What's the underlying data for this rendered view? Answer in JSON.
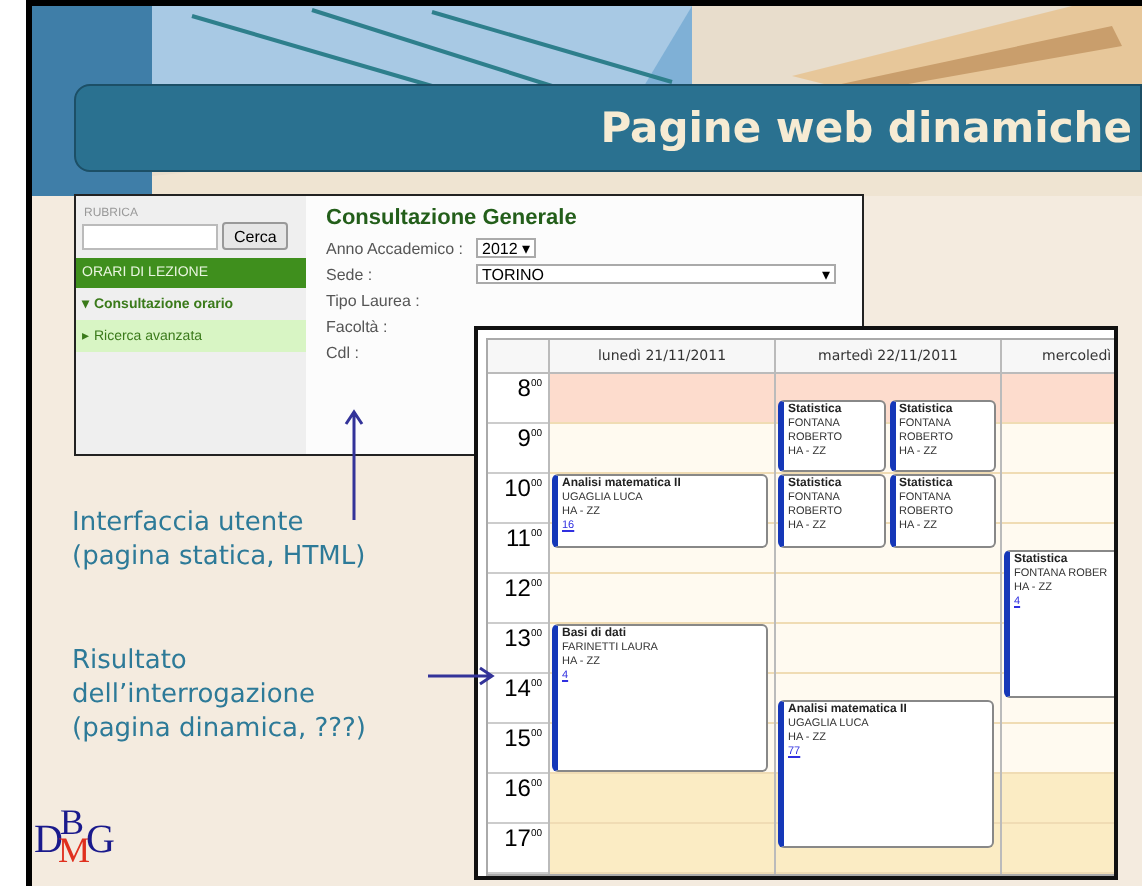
{
  "slide": {
    "title": "Pagine web dinamiche",
    "static_page": {
      "sidebar": {
        "label": "RUBRICA",
        "search_button": "Cerca",
        "section": "ORARI DI LEZIONE",
        "items": [
          {
            "marker": "▾",
            "label": "Consultazione orario",
            "selected": false
          },
          {
            "marker": "▸",
            "label": "Ricerca avanzata",
            "selected": true
          }
        ]
      },
      "heading": "Consultazione Generale",
      "fields": [
        {
          "label": "Anno Accademico :",
          "value": "2012",
          "kind": "short"
        },
        {
          "label": "Sede :",
          "value": "TORINO",
          "kind": "wide"
        },
        {
          "label": "Tipo Laurea :",
          "kind": "hidden"
        },
        {
          "label": "Facoltà :",
          "kind": "none"
        },
        {
          "label": "Cdl :",
          "kind": "none"
        }
      ]
    },
    "timetable": {
      "days": [
        "lunedì 21/11/2011",
        "martedì 22/11/2011",
        "mercoledì"
      ],
      "hours": [
        "8$^{00}$",
        "9$^{00}$",
        "10$^{00}$",
        "11$^{00}$",
        "12$^{00}$",
        "13$^{00}$",
        "14$^{00}$",
        "15$^{00}$",
        "16$^{00}$",
        "17$^{00}$"
      ],
      "events": [
        {
          "course": "Analisi matematica II",
          "lines": [
            "UGAGLIA LUCA",
            "HA - ZZ"
          ],
          "room": "16"
        },
        {
          "course": "Basi di dati",
          "lines": [
            "FARINETTI LAURA",
            "HA - ZZ"
          ],
          "room": "4"
        },
        {
          "course": "Statistica",
          "lines": [
            "FONTANA",
            "ROBERTO",
            "HA - ZZ"
          ]
        },
        {
          "course": "Statistica",
          "lines": [
            "FONTANA",
            "ROBERTO",
            "HA - ZZ"
          ]
        },
        {
          "course": "Statistica",
          "lines": [
            "FONTANA",
            "ROBERTO",
            "HA - ZZ"
          ]
        },
        {
          "course": "Statistica",
          "lines": [
            "FONTANA",
            "ROBERTO",
            "HA - ZZ"
          ]
        },
        {
          "course": "Analisi matematica II",
          "lines": [
            "UGAGLIA LUCA",
            "HA - ZZ"
          ],
          "room": "77"
        },
        {
          "course": "Statistica",
          "lines": [
            "FONTANA ROBER",
            "HA - ZZ"
          ],
          "room": "4"
        }
      ]
    },
    "notes": [
      {
        "lines": [
          "Interfaccia utente",
          "(pagina statica, HTML)"
        ],
        "kind": "up"
      },
      {
        "lines": [
          "Risultato",
          "dell’interrogazione",
          "(pagina dinamica, ???)"
        ],
        "kind": "right"
      }
    ],
    "logo": [
      "D",
      "B",
      "M",
      "G"
    ]
  }
}
